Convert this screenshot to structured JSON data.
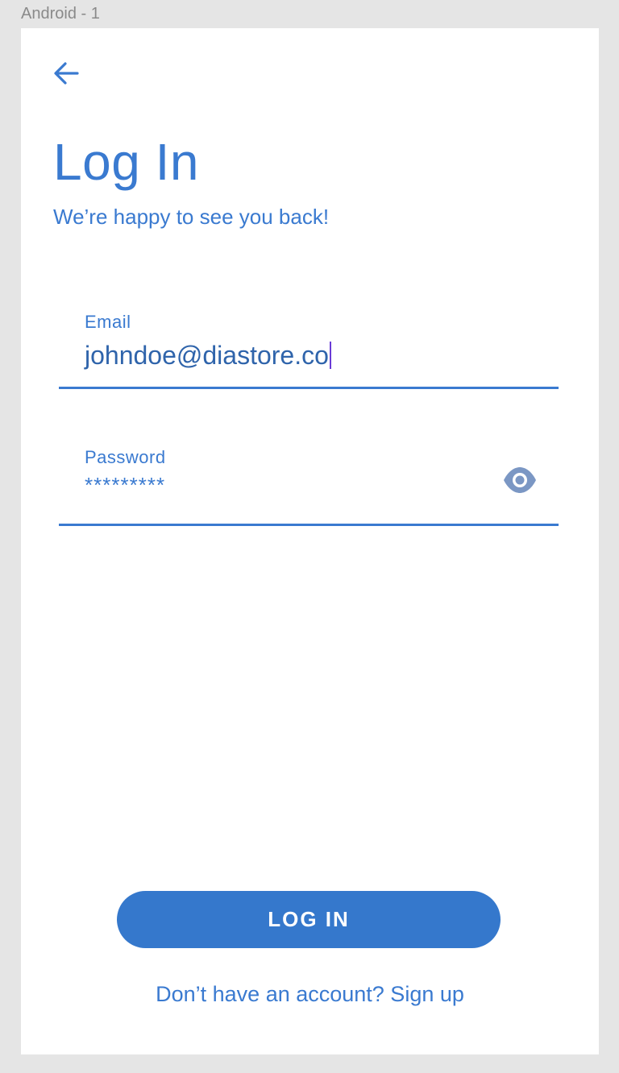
{
  "frame": {
    "label": "Android - 1"
  },
  "header": {
    "back_icon": "arrow-left-icon",
    "title": "Log In",
    "subtitle": "We’re happy to see you back!"
  },
  "form": {
    "email": {
      "label": "Email",
      "value": "johndoe@diastore.co"
    },
    "password": {
      "label": "Password",
      "value": "*********",
      "toggle_icon": "eye-icon"
    }
  },
  "actions": {
    "login_label": "LOG IN",
    "signup_text": "Don’t have an account? Sign up"
  },
  "colors": {
    "accent": "#3a7ad0",
    "button": "#3578cc",
    "eye_icon": "#7b97c4",
    "caret": "#6a3bd6",
    "canvas": "#e5e5e5",
    "screen": "#ffffff"
  }
}
